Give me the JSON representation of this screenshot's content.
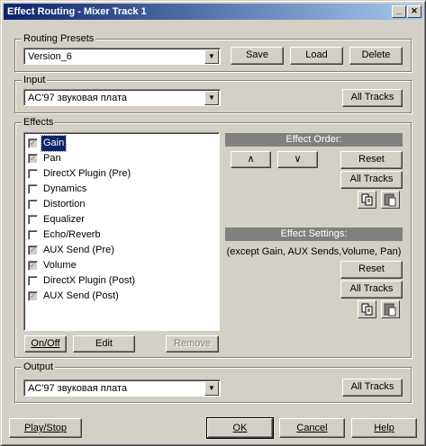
{
  "window": {
    "title": "Effect Routing - Mixer Track 1",
    "minimize_icon": "minimize-icon",
    "close_icon": "close-icon"
  },
  "routing_presets": {
    "label": "Routing Presets",
    "value": "Version_6",
    "save": "Save",
    "load": "Load",
    "delete": "Delete"
  },
  "input": {
    "label": "Input",
    "value": "AC'97 звуковая плата",
    "all_tracks": "All Tracks"
  },
  "effects": {
    "label": "Effects",
    "items": [
      {
        "label": "Gain",
        "checked": true,
        "locked": true,
        "selected": true
      },
      {
        "label": "Pan",
        "checked": true,
        "locked": true
      },
      {
        "label": "DirectX Plugin (Pre)",
        "checked": false
      },
      {
        "label": "Dynamics",
        "checked": false
      },
      {
        "label": "Distortion",
        "checked": false
      },
      {
        "label": "Equalizer",
        "checked": false
      },
      {
        "label": "Echo/Reverb",
        "checked": false
      },
      {
        "label": "AUX Send (Pre)",
        "checked": true,
        "locked": true
      },
      {
        "label": "Volume",
        "checked": true,
        "locked": true
      },
      {
        "label": "DirectX Plugin (Post)",
        "checked": false
      },
      {
        "label": "AUX Send (Post)",
        "checked": true,
        "locked": true
      }
    ],
    "on_off": "On/Off",
    "edit": "Edit",
    "remove": "Remove",
    "order": {
      "header": "Effect Order:",
      "up_icon": "arrow-up-icon",
      "down_icon": "arrow-down-icon",
      "reset": "Reset",
      "all_tracks": "All Tracks",
      "copy_icon": "copy-icon",
      "paste_icon": "paste-icon"
    },
    "settings": {
      "header": "Effect Settings:",
      "note": "(except Gain, AUX Sends,Volume, Pan)",
      "reset": "Reset",
      "all_tracks": "All Tracks",
      "copy_icon": "copy-icon",
      "paste_icon": "paste-icon"
    }
  },
  "output": {
    "label": "Output",
    "value": "AC'97 звуковая плата",
    "all_tracks": "All Tracks"
  },
  "footer": {
    "play_stop": "Play/Stop",
    "ok": "OK",
    "cancel": "Cancel",
    "help": "Help"
  }
}
